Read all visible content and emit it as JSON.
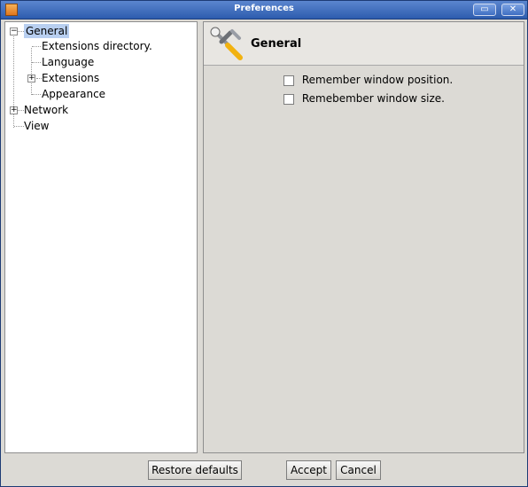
{
  "window": {
    "title": "Preferences",
    "minimize_label": "▭",
    "close_label": "✕"
  },
  "tree": {
    "items": [
      {
        "label": "General",
        "expander": "−"
      },
      {
        "label": "Extensions directory."
      },
      {
        "label": "Language"
      },
      {
        "label": "Extensions",
        "expander": "+"
      },
      {
        "label": "Appearance"
      },
      {
        "label": "Network",
        "expander": "+"
      },
      {
        "label": "View"
      }
    ]
  },
  "content": {
    "title": "General",
    "options": [
      {
        "label": "Remember window position.",
        "checked": false
      },
      {
        "label": "Remebember window size.",
        "checked": false
      }
    ]
  },
  "buttons": {
    "restore": "Restore defaults",
    "accept": "Accept",
    "cancel": "Cancel"
  }
}
